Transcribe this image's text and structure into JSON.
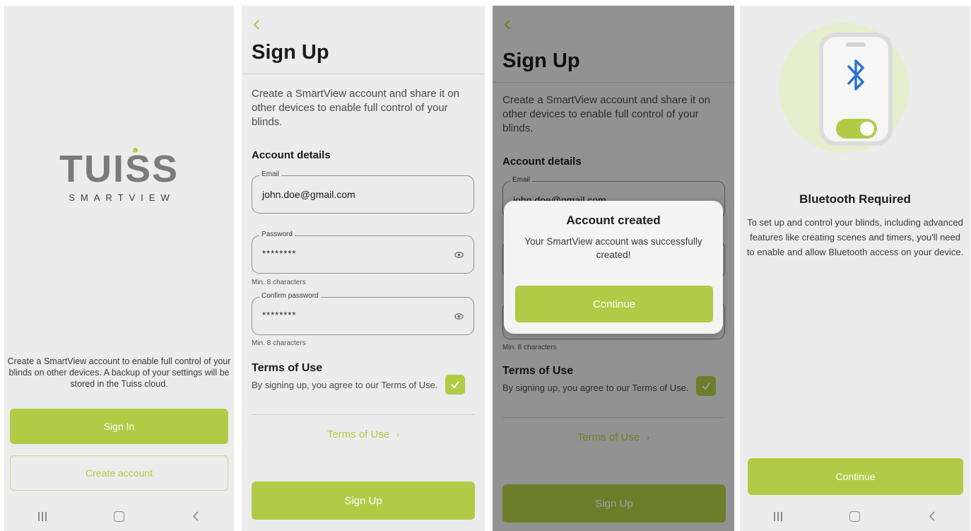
{
  "screen1": {
    "logo_word": "TUISS",
    "logo_sub": "SMARTVIEW",
    "description": "Create a SmartView account to enable full control of your blinds on other devices. A backup of your settings will be stored in the Tuiss cloud.",
    "sign_in_label": "Sign In",
    "create_account_label": "Create account"
  },
  "signup": {
    "title": "Sign Up",
    "description": "Create a SmartView account and share it on other devices to enable full control of your blinds.",
    "section_title": "Account details",
    "email_label": "Email",
    "email_value": "john.doe@gmail.com",
    "password_label": "Password",
    "password_value": "********",
    "password_hint": "Min. 8 characters",
    "confirm_label": "Confirm password",
    "confirm_value": "********",
    "confirm_hint": "Min. 8 characters",
    "terms_title": "Terms of Use",
    "terms_text": "By signing up, you agree to our Terms of Use.",
    "terms_link": "Terms of Use",
    "terms_checked": true,
    "submit_label": "Sign Up"
  },
  "dialog": {
    "title": "Account created",
    "message": "Your SmartView account was successfully created!",
    "continue_label": "Continue"
  },
  "bluetooth": {
    "title": "Bluetooth Required",
    "description": "To set up and control your blinds, including advanced features like creating scenes and timers, you'll need to enable and allow Bluetooth access on your device.",
    "continue_label": "Continue"
  },
  "colors": {
    "accent": "#b1cb46",
    "background": "#ececec",
    "bluetooth": "#2c6fd6"
  },
  "icons": [
    "recent-apps-icon",
    "home-icon",
    "back-icon",
    "chevron-left-icon",
    "eye-icon",
    "check-icon",
    "chevron-right-icon",
    "bluetooth-icon"
  ]
}
